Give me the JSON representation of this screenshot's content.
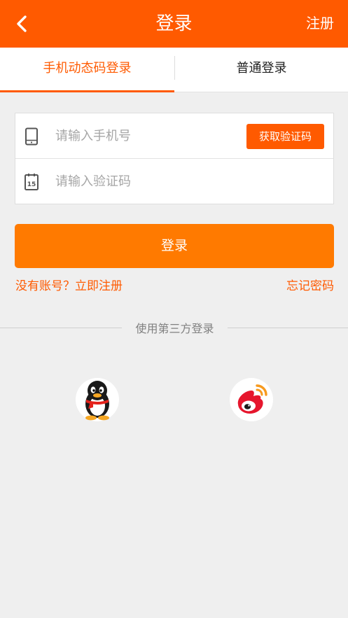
{
  "header": {
    "title": "登录",
    "register_label": "注册",
    "back_icon": "chevron-left-icon",
    "bg_color": "#ff5a00"
  },
  "tabs": [
    {
      "label": "手机动态码登录",
      "active": true
    },
    {
      "label": "普通登录",
      "active": false
    }
  ],
  "form": {
    "phone": {
      "placeholder": "请输入手机号",
      "value": "",
      "icon": "phone-icon"
    },
    "get_code_label": "获取验证码",
    "code": {
      "placeholder": "请输入验证码",
      "value": "",
      "icon": "calendar-icon",
      "icon_text": "15"
    }
  },
  "login_button_label": "登录",
  "links": {
    "register": "没有账号？立即注册",
    "forgot": "忘记密码"
  },
  "third_party": {
    "label": "使用第三方登录",
    "providers": [
      {
        "icon": "qq-icon"
      },
      {
        "icon": "weibo-icon"
      }
    ]
  },
  "colors": {
    "accent": "#ff5a00",
    "button": "#ff7a00",
    "background": "#efefef"
  }
}
